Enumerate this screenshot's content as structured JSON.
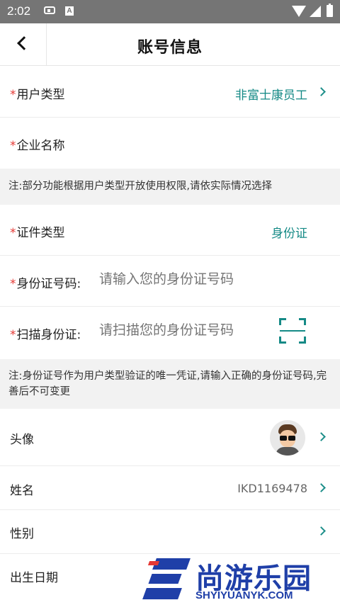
{
  "status_bar": {
    "time": "2:02",
    "app_badge": "A"
  },
  "header": {
    "title": "账号信息"
  },
  "user_type": {
    "label": "用户类型",
    "value": "非富士康员工"
  },
  "company": {
    "label": "企业名称"
  },
  "note1": "注:部分功能根据用户类型开放使用权限,请依实际情况选择",
  "id_type": {
    "label": "证件类型",
    "value": "身份证"
  },
  "id_number": {
    "label": "身份证号码:",
    "placeholder": "请输入您的身份证号码"
  },
  "scan_id": {
    "label": "扫描身份证:",
    "placeholder": "请扫描您的身份证号码"
  },
  "note2": "注:身份证号作为用户类型验证的唯一凭证,请输入正确的身份证号码,完善后不可变更",
  "avatar_row": {
    "label": "头像"
  },
  "name_row": {
    "label": "姓名",
    "value": "IKD1169478"
  },
  "gender_row": {
    "label": "性别"
  },
  "birth_row": {
    "label": "出生日期"
  },
  "required_mark": "*",
  "watermark": {
    "brand": "尚游乐园",
    "domain": "SHYIYUANYK.COM"
  },
  "colors": {
    "accent": "#158a86",
    "required": "#e53935",
    "status_bar": "#757575",
    "watermark": "#1f3fa8"
  }
}
